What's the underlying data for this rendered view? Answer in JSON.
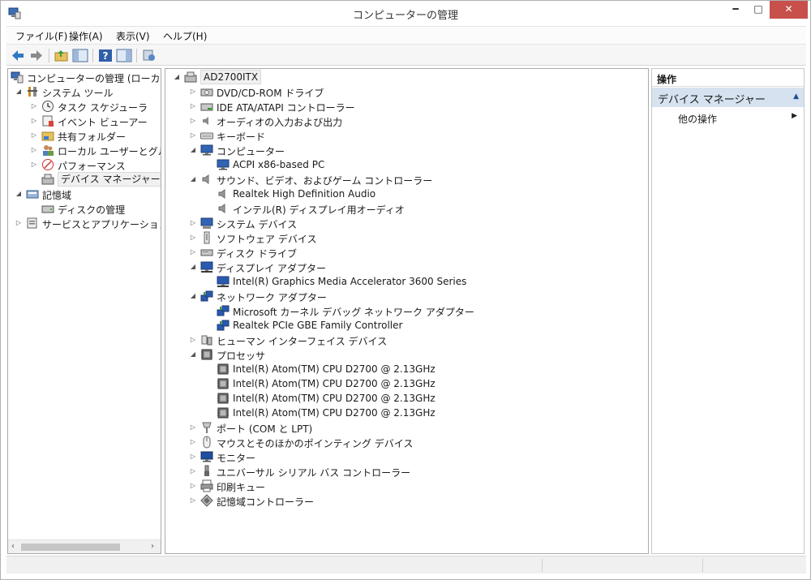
{
  "window": {
    "title": "コンピューターの管理",
    "minimize": "━",
    "maximize": "□",
    "close": "✕"
  },
  "menu": [
    "ファイル(F)",
    "操作(A)",
    "表示(V)",
    "ヘルプ(H)"
  ],
  "toolbar": [
    "back-arrow-icon",
    "forward-arrow-icon",
    "up-folder-icon",
    "show-hide-tree-icon",
    "help-icon",
    "show-hide-action-pane-icon",
    "properties-icon"
  ],
  "left_tree": [
    {
      "label": "コンピューターの管理 (ローカル)",
      "arrow": "",
      "icon": "computer-management-icon",
      "level": 0
    },
    {
      "label": "システム ツール",
      "arrow": "◢",
      "icon": "system-tools-icon",
      "level": 1
    },
    {
      "label": "タスク スケジューラ",
      "arrow": "▷",
      "icon": "task-scheduler-icon",
      "level": 2
    },
    {
      "label": "イベント ビューアー",
      "arrow": "▷",
      "icon": "event-viewer-icon",
      "level": 2
    },
    {
      "label": "共有フォルダー",
      "arrow": "▷",
      "icon": "shared-folder-icon",
      "level": 2
    },
    {
      "label": "ローカル ユーザーとグループ",
      "arrow": "▷",
      "icon": "local-users-icon",
      "level": 2
    },
    {
      "label": "パフォーマンス",
      "arrow": "▷",
      "icon": "performance-icon",
      "level": 2
    },
    {
      "label": "デバイス マネージャー",
      "arrow": "",
      "icon": "device-manager-icon",
      "level": 2,
      "selected": true
    },
    {
      "label": "記憶域",
      "arrow": "◢",
      "icon": "storage-icon",
      "level": 1
    },
    {
      "label": "ディスクの管理",
      "arrow": "",
      "icon": "disk-management-icon",
      "level": 2
    },
    {
      "label": "サービスとアプリケーション",
      "arrow": "▷",
      "icon": "services-apps-icon",
      "level": 1
    }
  ],
  "left_scroll": {
    "left": "‹",
    "right": "›"
  },
  "device_tree": [
    {
      "label": "AD2700ITX",
      "arrow": "◢",
      "icon": "computer-root-icon",
      "level": 0,
      "selected": true
    },
    {
      "label": "DVD/CD-ROM ドライブ",
      "arrow": "▷",
      "icon": "dvd-drive-icon",
      "level": 1
    },
    {
      "label": "IDE ATA/ATAPI コントローラー",
      "arrow": "▷",
      "icon": "ide-controller-icon",
      "level": 1
    },
    {
      "label": "オーディオの入力および出力",
      "arrow": "▷",
      "icon": "audio-io-icon",
      "level": 1
    },
    {
      "label": "キーボード",
      "arrow": "▷",
      "icon": "keyboard-icon",
      "level": 1
    },
    {
      "label": "コンピューター",
      "arrow": "◢",
      "icon": "computer-icon",
      "level": 1
    },
    {
      "label": "ACPI x86-based PC",
      "arrow": "",
      "icon": "computer-icon",
      "level": 2
    },
    {
      "label": "サウンド、ビデオ、およびゲーム コントローラー",
      "arrow": "◢",
      "icon": "speaker-icon",
      "level": 1
    },
    {
      "label": "Realtek High Definition Audio",
      "arrow": "",
      "icon": "speaker-icon",
      "level": 2
    },
    {
      "label": "インテル(R) ディスプレイ用オーディオ",
      "arrow": "",
      "icon": "speaker-icon",
      "level": 2
    },
    {
      "label": "システム デバイス",
      "arrow": "▷",
      "icon": "system-device-icon",
      "level": 1
    },
    {
      "label": "ソフトウェア デバイス",
      "arrow": "▷",
      "icon": "software-device-icon",
      "level": 1
    },
    {
      "label": "ディスク ドライブ",
      "arrow": "▷",
      "icon": "disk-drive-icon",
      "level": 1
    },
    {
      "label": "ディスプレイ アダプター",
      "arrow": "◢",
      "icon": "display-adapter-icon",
      "level": 1
    },
    {
      "label": "Intel(R) Graphics Media Accelerator 3600 Series",
      "arrow": "",
      "icon": "display-adapter-icon",
      "level": 2
    },
    {
      "label": "ネットワーク アダプター",
      "arrow": "◢",
      "icon": "network-adapter-icon",
      "level": 1
    },
    {
      "label": "Microsoft カーネル デバッグ ネットワーク アダプター",
      "arrow": "",
      "icon": "network-adapter-icon",
      "level": 2
    },
    {
      "label": "Realtek PCIe GBE Family Controller",
      "arrow": "",
      "icon": "network-adapter-icon",
      "level": 2
    },
    {
      "label": "ヒューマン インターフェイス デバイス",
      "arrow": "▷",
      "icon": "hid-icon",
      "level": 1
    },
    {
      "label": "プロセッサ",
      "arrow": "◢",
      "icon": "processor-icon",
      "level": 1
    },
    {
      "label": "Intel(R) Atom(TM) CPU D2700   @ 2.13GHz",
      "arrow": "",
      "icon": "processor-icon",
      "level": 2
    },
    {
      "label": "Intel(R) Atom(TM) CPU D2700   @ 2.13GHz",
      "arrow": "",
      "icon": "processor-icon",
      "level": 2
    },
    {
      "label": "Intel(R) Atom(TM) CPU D2700   @ 2.13GHz",
      "arrow": "",
      "icon": "processor-icon",
      "level": 2
    },
    {
      "label": "Intel(R) Atom(TM) CPU D2700   @ 2.13GHz",
      "arrow": "",
      "icon": "processor-icon",
      "level": 2
    },
    {
      "label": "ポート (COM と LPT)",
      "arrow": "▷",
      "icon": "port-icon",
      "level": 1
    },
    {
      "label": "マウスとそのほかのポインティング デバイス",
      "arrow": "▷",
      "icon": "mouse-icon",
      "level": 1
    },
    {
      "label": "モニター",
      "arrow": "▷",
      "icon": "monitor-icon",
      "level": 1
    },
    {
      "label": "ユニバーサル シリアル バス コントローラー",
      "arrow": "▷",
      "icon": "usb-icon",
      "level": 1
    },
    {
      "label": "印刷キュー",
      "arrow": "▷",
      "icon": "printer-icon",
      "level": 1
    },
    {
      "label": "記憶域コントローラー",
      "arrow": "▷",
      "icon": "storage-controller-icon",
      "level": 1
    }
  ],
  "actions": {
    "header": "操作",
    "section": "デバイス マネージャー",
    "section_arrow": "▲",
    "item": "他の操作",
    "item_arrow": "▶"
  },
  "colors": {
    "selection": "#d6e2ef",
    "close_button": "#c7504b"
  }
}
